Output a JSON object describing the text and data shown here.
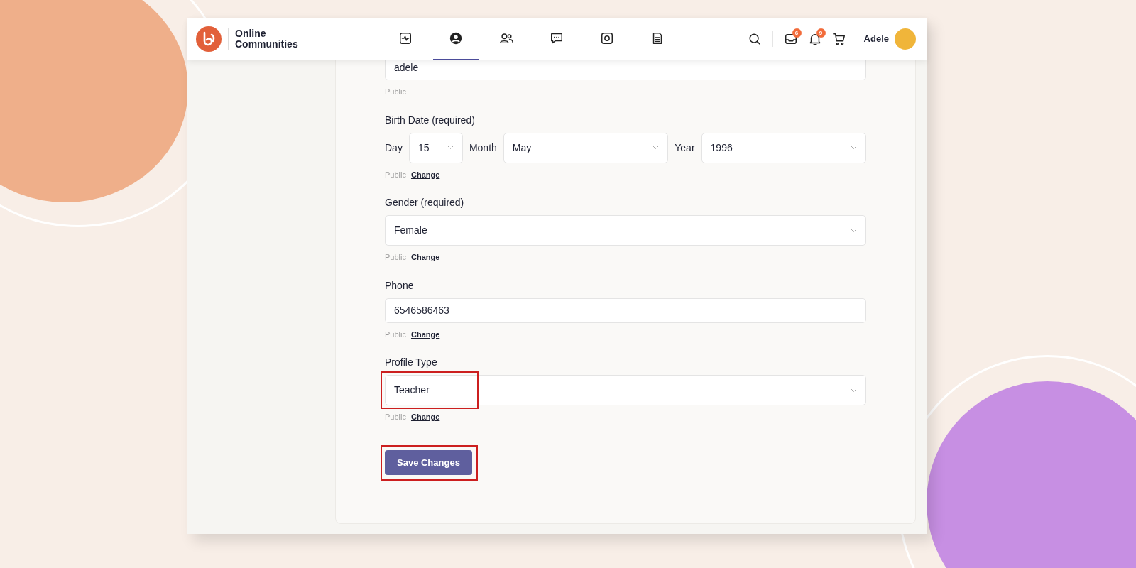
{
  "header": {
    "brand": "Online Communities",
    "nav_items": [
      {
        "kind": "activity",
        "selected": false
      },
      {
        "kind": "profile",
        "selected": true
      },
      {
        "kind": "members",
        "selected": false
      },
      {
        "kind": "messages",
        "selected": false
      },
      {
        "kind": "photos",
        "selected": false
      },
      {
        "kind": "documents",
        "selected": false
      }
    ],
    "actions": [
      {
        "kind": "search"
      },
      {
        "kind": "inbox",
        "badge": "6"
      },
      {
        "kind": "bell",
        "badge": "9"
      },
      {
        "kind": "cart"
      }
    ],
    "user_name": "Adele"
  },
  "form": {
    "fields": [
      {
        "kind": "text",
        "value": "adele",
        "visibility": "Public",
        "highlighted": false
      },
      {
        "kind": "date",
        "label": "Birth Date (required)",
        "parts": [
          {
            "label": "Day",
            "value": "15"
          },
          {
            "label": "Month",
            "value": "May"
          },
          {
            "label": "Year",
            "value": "1996"
          }
        ],
        "visibility": "Public",
        "change": "Change",
        "highlighted": false
      },
      {
        "kind": "select",
        "label": "Gender (required)",
        "value": "Female",
        "visibility": "Public",
        "change": "Change",
        "highlighted": false
      },
      {
        "kind": "text",
        "label": "Phone",
        "value": "6546586463",
        "visibility": "Public",
        "change": "Change",
        "highlighted": false
      },
      {
        "kind": "select",
        "label": "Profile Type",
        "value": "Teacher",
        "visibility": "Public",
        "change": "Change",
        "highlighted": true
      }
    ],
    "save_button": {
      "label": "Save Changes",
      "highlighted": true
    }
  }
}
